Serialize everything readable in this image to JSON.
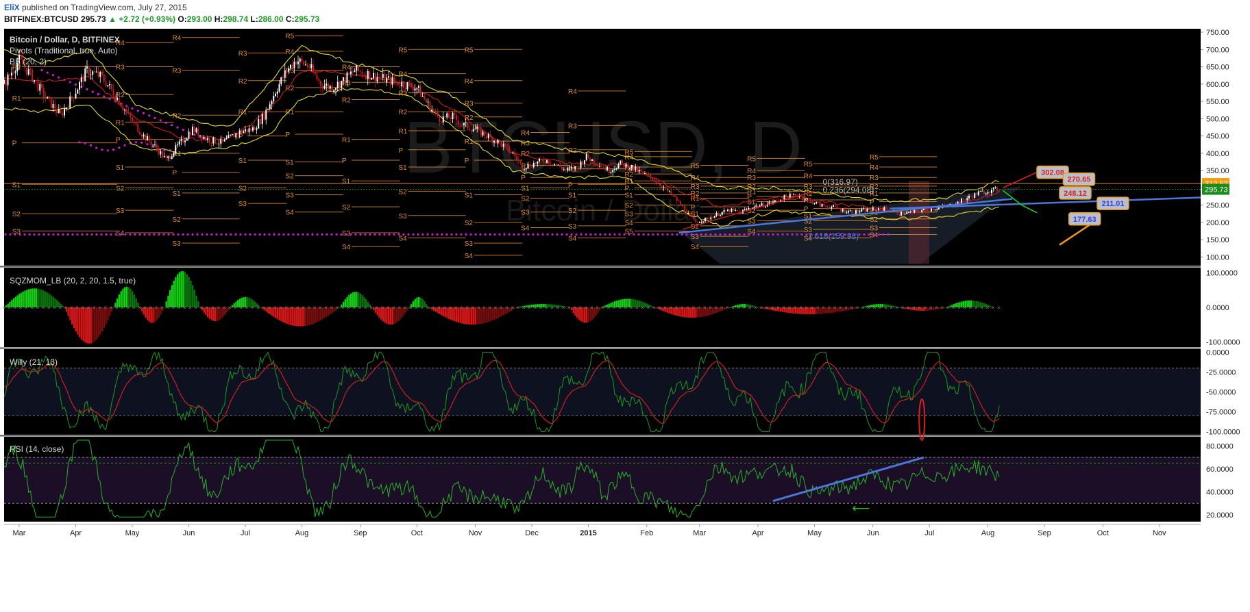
{
  "header": {
    "author": "EliX",
    "published": "published on TradingView.com, July 27, 2015",
    "symbol": "BITFINEX:BTCUSD",
    "last": "295.73",
    "change": "+2.72 (+0.93%)",
    "o_label": "O:",
    "o": "293.00",
    "h_label": "H:",
    "h": "298.74",
    "l_label": "L:",
    "l": "286.00",
    "c_label": "C:",
    "c": "295.73"
  },
  "watermark": {
    "main": "BTCUSD, D",
    "sub": "Bitcoin / Dollar"
  },
  "legends": {
    "price": "Bitcoin / Dollar, D, BITFINEX",
    "pivots": "Pivots (Traditional, true, Auto)",
    "bb": "BB (20, 2)",
    "sqz": "SQZMOM_LB (20, 2, 20, 1.5, true)",
    "willy": "Willy (21, 13)",
    "rsi": "RSI (14, close)"
  },
  "colors": {
    "background": "#000000",
    "candle_up": "#ffffff",
    "candle_down": "#c41a1a",
    "bollinger": "#e6dd24",
    "bb_basis": "#d21a1a",
    "pivot_line": "#e08a2a",
    "pivot_text": "#e38e2f",
    "sar_dots": "#d418d4",
    "trendline": "#4a78d8",
    "fib_text": "#b9b9b9",
    "squeeze_up": "#11d311",
    "squeeze_down": "#d81818",
    "willy_fast": "#1f9a1f",
    "willy_slow": "#d11f1f",
    "rsi": "#27b527",
    "axis_text": "#222222",
    "price_tag": "#1a8c1a",
    "resistance_tag": "#f39c12",
    "callout_red": "#e01d1d"
  },
  "chart_data": [
    {
      "type": "line",
      "name": "price",
      "subtype": "candlestick",
      "timeframe": "D",
      "x_months": [
        "Mar",
        "Apr",
        "May",
        "Jun",
        "Jul",
        "Aug",
        "Sep",
        "Oct",
        "Nov",
        "Dec",
        "2015",
        "Feb",
        "Mar",
        "Apr",
        "May",
        "Jun",
        "Jul",
        "Aug",
        "Sep",
        "Oct",
        "Nov"
      ],
      "yticks": [
        "750.00",
        "700.00",
        "650.00",
        "600.00",
        "550.00",
        "500.00",
        "450.00",
        "400.00",
        "350.00",
        "300.00",
        "250.00",
        "200.00",
        "150.00",
        "100.00"
      ],
      "ylim": [
        75,
        760
      ],
      "close_path": [
        [
          0,
          600
        ],
        [
          8,
          670
        ],
        [
          15,
          620
        ],
        [
          22,
          560
        ],
        [
          30,
          510
        ],
        [
          37,
          570
        ],
        [
          44,
          640
        ],
        [
          52,
          620
        ],
        [
          60,
          560
        ],
        [
          67,
          500
        ],
        [
          74,
          450
        ],
        [
          80,
          420
        ],
        [
          86,
          380
        ],
        [
          92,
          420
        ],
        [
          100,
          470
        ],
        [
          108,
          440
        ],
        [
          116,
          430
        ],
        [
          124,
          460
        ],
        [
          132,
          470
        ],
        [
          138,
          510
        ],
        [
          144,
          580
        ],
        [
          150,
          640
        ],
        [
          155,
          670
        ],
        [
          162,
          650
        ],
        [
          168,
          600
        ],
        [
          174,
          590
        ],
        [
          180,
          610
        ],
        [
          186,
          640
        ],
        [
          192,
          630
        ],
        [
          198,
          620
        ],
        [
          205,
          610
        ],
        [
          212,
          600
        ],
        [
          219,
          590
        ],
        [
          225,
          540
        ],
        [
          231,
          500
        ],
        [
          238,
          505
        ],
        [
          244,
          480
        ],
        [
          250,
          470
        ],
        [
          256,
          450
        ],
        [
          263,
          430
        ],
        [
          270,
          400
        ],
        [
          275,
          360
        ],
        [
          281,
          370
        ],
        [
          287,
          380
        ],
        [
          292,
          370
        ],
        [
          298,
          350
        ],
        [
          304,
          360
        ],
        [
          309,
          390
        ],
        [
          315,
          370
        ],
        [
          321,
          350
        ],
        [
          327,
          370
        ],
        [
          333,
          360
        ],
        [
          339,
          340
        ],
        [
          345,
          325
        ],
        [
          350,
          300
        ],
        [
          356,
          270
        ],
        [
          362,
          230
        ],
        [
          367,
          200
        ],
        [
          373,
          210
        ],
        [
          379,
          225
        ],
        [
          385,
          235
        ],
        [
          391,
          230
        ],
        [
          397,
          245
        ],
        [
          403,
          250
        ],
        [
          409,
          260
        ],
        [
          415,
          275
        ],
        [
          421,
          280
        ],
        [
          427,
          265
        ],
        [
          433,
          250
        ],
        [
          439,
          245
        ],
        [
          445,
          235
        ],
        [
          451,
          230
        ],
        [
          457,
          235
        ],
        [
          463,
          240
        ],
        [
          469,
          238
        ],
        [
          475,
          225
        ],
        [
          481,
          228
        ],
        [
          487,
          235
        ],
        [
          493,
          240
        ],
        [
          499,
          245
        ],
        [
          505,
          255
        ],
        [
          511,
          270
        ],
        [
          517,
          285
        ],
        [
          523,
          292
        ],
        [
          528,
          296
        ]
      ],
      "bb_upper_path": [
        [
          0,
          700
        ],
        [
          20,
          660
        ],
        [
          45,
          700
        ],
        [
          70,
          540
        ],
        [
          95,
          500
        ],
        [
          120,
          475
        ],
        [
          140,
          600
        ],
        [
          158,
          710
        ],
        [
          185,
          660
        ],
        [
          215,
          620
        ],
        [
          240,
          560
        ],
        [
          270,
          440
        ],
        [
          300,
          410
        ],
        [
          330,
          390
        ],
        [
          355,
          350
        ],
        [
          380,
          300
        ],
        [
          410,
          300
        ],
        [
          440,
          280
        ],
        [
          470,
          262
        ],
        [
          500,
          270
        ],
        [
          528,
          320
        ]
      ],
      "bb_basis_path": [
        [
          0,
          620
        ],
        [
          20,
          610
        ],
        [
          45,
          620
        ],
        [
          70,
          500
        ],
        [
          95,
          440
        ],
        [
          120,
          445
        ],
        [
          140,
          520
        ],
        [
          158,
          640
        ],
        [
          185,
          630
        ],
        [
          215,
          600
        ],
        [
          240,
          520
        ],
        [
          270,
          400
        ],
        [
          300,
          370
        ],
        [
          330,
          365
        ],
        [
          355,
          300
        ],
        [
          380,
          245
        ],
        [
          410,
          275
        ],
        [
          440,
          255
        ],
        [
          470,
          235
        ],
        [
          500,
          245
        ],
        [
          528,
          285
        ]
      ],
      "bb_lower_path": [
        [
          0,
          530
        ],
        [
          20,
          520
        ],
        [
          45,
          540
        ],
        [
          70,
          420
        ],
        [
          95,
          400
        ],
        [
          120,
          420
        ],
        [
          140,
          450
        ],
        [
          158,
          560
        ],
        [
          185,
          590
        ],
        [
          215,
          570
        ],
        [
          240,
          470
        ],
        [
          270,
          350
        ],
        [
          300,
          330
        ],
        [
          330,
          330
        ],
        [
          355,
          240
        ],
        [
          380,
          190
        ],
        [
          410,
          235
        ],
        [
          440,
          220
        ],
        [
          470,
          210
        ],
        [
          500,
          215
        ],
        [
          528,
          245
        ]
      ],
      "sar_dots": {
        "y": 165,
        "label": "parabolic SAR"
      },
      "pivot_labels": [
        "R5",
        "R4",
        "R3",
        "R2",
        "R1",
        "P",
        "S1",
        "S2",
        "S3",
        "S4",
        "S5"
      ],
      "fib_levels": [
        {
          "label": "0(316.97)",
          "value": 316.97
        },
        {
          "label": "0.236(294.08)",
          "value": 294.08
        },
        {
          "label": "1.618(159.98)",
          "value": 159.98
        }
      ],
      "price_tags": [
        {
          "label": "312.52",
          "value": 312.52
        },
        {
          "label": "295.73",
          "value": 295.73
        }
      ],
      "callouts": [
        {
          "label": "302.08",
          "value": 302.08
        },
        {
          "label": "270.65",
          "value": 270.65
        },
        {
          "label": "248.12",
          "value": 248.12
        },
        {
          "label": "211.01",
          "value": 211.01
        },
        {
          "label": "177.63",
          "value": 177.63
        }
      ]
    },
    {
      "type": "bar",
      "name": "squeeze momentum",
      "yticks": [
        "100.0000",
        "0.0000",
        "-100.0000"
      ],
      "ylim": [
        -115,
        115
      ],
      "segments": [
        {
          "x0": 0,
          "x1": 32,
          "peak": 55
        },
        {
          "x0": 32,
          "x1": 58,
          "peak": -105
        },
        {
          "x0": 58,
          "x1": 72,
          "peak": 60
        },
        {
          "x0": 72,
          "x1": 85,
          "peak": -45
        },
        {
          "x0": 85,
          "x1": 104,
          "peak": 105
        },
        {
          "x0": 104,
          "x1": 120,
          "peak": -40
        },
        {
          "x0": 120,
          "x1": 136,
          "peak": 30
        },
        {
          "x0": 136,
          "x1": 178,
          "peak": -55
        },
        {
          "x0": 178,
          "x1": 195,
          "peak": 45
        },
        {
          "x0": 195,
          "x1": 215,
          "peak": -50
        },
        {
          "x0": 215,
          "x1": 225,
          "peak": 30
        },
        {
          "x0": 225,
          "x1": 272,
          "peak": -50
        },
        {
          "x0": 272,
          "x1": 300,
          "peak": 10
        },
        {
          "x0": 300,
          "x1": 317,
          "peak": -45
        },
        {
          "x0": 317,
          "x1": 345,
          "peak": 25
        },
        {
          "x0": 345,
          "x1": 385,
          "peak": -30
        },
        {
          "x0": 385,
          "x1": 400,
          "peak": 10
        },
        {
          "x0": 400,
          "x1": 455,
          "peak": -20
        },
        {
          "x0": 455,
          "x1": 475,
          "peak": 10
        },
        {
          "x0": 475,
          "x1": 500,
          "peak": -10
        },
        {
          "x0": 500,
          "x1": 525,
          "peak": 20
        }
      ]
    },
    {
      "type": "line",
      "name": "willy",
      "yticks": [
        "0.0000",
        "-25.0000",
        "-50.0000",
        "-75.0000",
        "-100.0000"
      ],
      "ylim": [
        -104,
        4
      ],
      "levels": [
        -20,
        -80
      ]
    },
    {
      "type": "line",
      "name": "rsi",
      "yticks": [
        "80.0000",
        "60.0000",
        "40.0000",
        "20.0000"
      ],
      "ylim": [
        14,
        88
      ],
      "levels": [
        70,
        30,
        65
      ]
    }
  ]
}
